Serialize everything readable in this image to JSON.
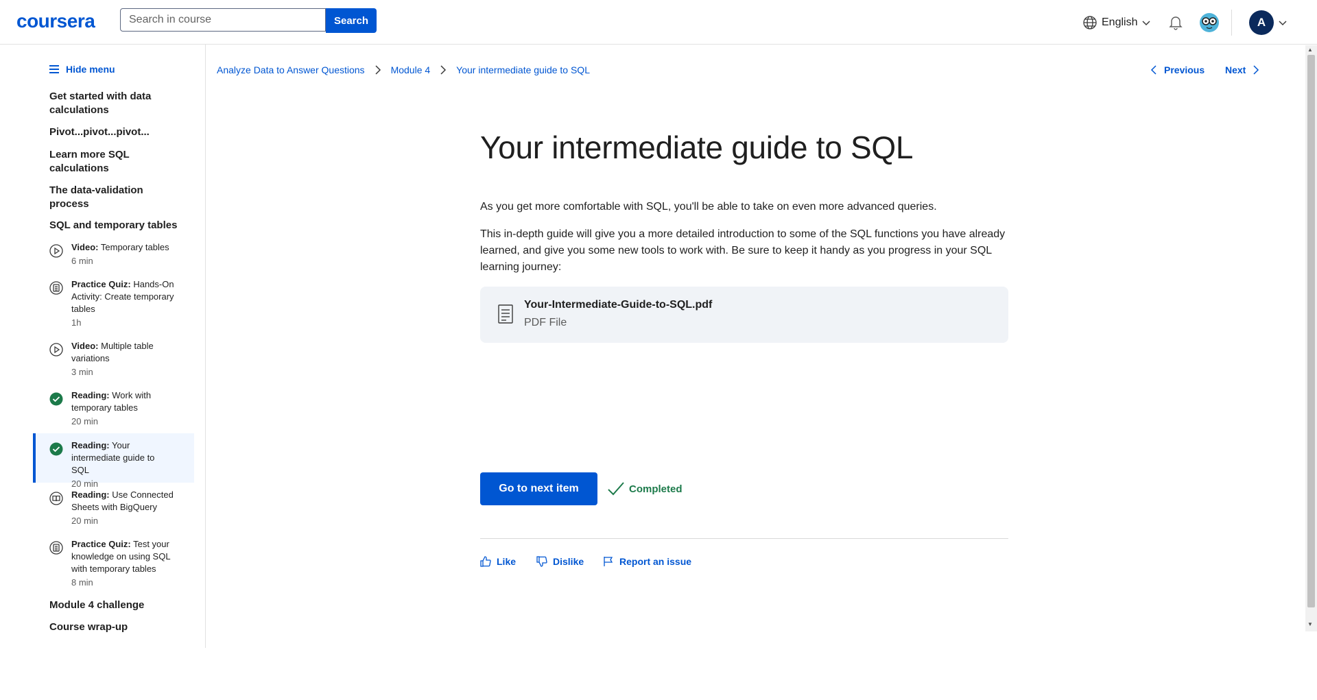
{
  "header": {
    "logo": "coursera",
    "search_placeholder": "Search in course",
    "search_button": "Search",
    "language": "English",
    "avatar_initial": "A"
  },
  "sidebar": {
    "hide_menu": "Hide menu",
    "sections": [
      "Get started with data calculations",
      "Pivot...pivot...pivot...",
      "Learn more SQL calculations",
      "The data-validation process",
      "SQL and temporary tables"
    ],
    "items": [
      {
        "type": "Video:",
        "title": "Temporary tables",
        "duration": "6 min",
        "icon": "play-icon"
      },
      {
        "type": "Practice Quiz:",
        "title": "Hands-On Activity: Create temporary tables",
        "duration": "1h",
        "icon": "quiz-icon"
      },
      {
        "type": "Video:",
        "title": "Multiple table variations",
        "duration": "3 min",
        "icon": "play-icon"
      },
      {
        "type": "Reading:",
        "title": "Work with temporary tables",
        "duration": "20 min",
        "icon": "check-circle-icon"
      },
      {
        "type": "Reading:",
        "title": "Your intermediate guide to SQL",
        "duration": "20 min",
        "icon": "check-circle-icon",
        "active": true
      },
      {
        "type": "Reading:",
        "title": "Use Connected Sheets with BigQuery",
        "duration": "20 min",
        "icon": "book-icon"
      },
      {
        "type": "Practice Quiz:",
        "title": "Test your knowledge on using SQL with temporary tables",
        "duration": "8 min",
        "icon": "quiz-icon"
      }
    ],
    "after_sections": [
      "Module 4 challenge",
      "Course wrap-up"
    ]
  },
  "breadcrumb": [
    "Analyze Data to Answer Questions",
    "Module 4",
    "Your intermediate guide to SQL"
  ],
  "nav": {
    "previous": "Previous",
    "next": "Next"
  },
  "content": {
    "title": "Your intermediate guide to SQL",
    "paragraph1": "As you get more comfortable with SQL, you'll be able to take on even more advanced queries.",
    "paragraph2": "This in-depth guide will give you a more detailed introduction to some of the SQL functions you have already learned, and give you some new tools to work with. Be sure to keep it handy as you progress in your SQL learning journey:",
    "file_name": "Your-Intermediate-Guide-to-SQL.pdf",
    "file_type": "PDF File",
    "next_button": "Go to next item",
    "completed": "Completed",
    "feedback": {
      "like": "Like",
      "dislike": "Dislike",
      "report": "Report an issue"
    }
  },
  "colors": {
    "brand": "#0056d2",
    "success": "#1c7a4a",
    "active_bg": "#f0f6ff"
  }
}
